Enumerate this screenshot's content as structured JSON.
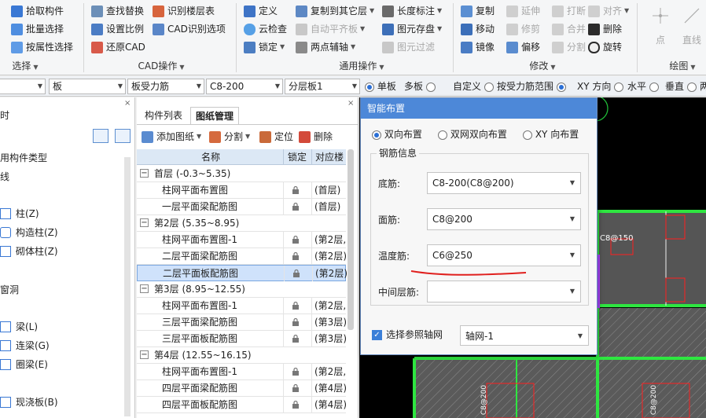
{
  "ribbon": {
    "col1": [
      "拾取构件",
      "批量选择",
      "按属性选择"
    ],
    "col2": [
      "查找替换",
      "设置比例",
      "还原CAD"
    ],
    "col3": [
      "识别楼层表",
      "CAD识别选项"
    ],
    "col4": [
      "定义",
      "云检查",
      "锁定"
    ],
    "col5": [
      "复制到其它层",
      "自动平齐板",
      "两点辅轴"
    ],
    "col6": [
      "长度标注",
      "图元存盘",
      "图元过滤"
    ],
    "col7": [
      "复制",
      "移动",
      "镜像"
    ],
    "col8": [
      "延伸",
      "修剪",
      "偏移"
    ],
    "col9": [
      "打断",
      "合并",
      "分割"
    ],
    "col10": [
      "对齐",
      "删除",
      "旋转"
    ],
    "col11": [
      "点",
      "直线"
    ],
    "groups": [
      "选择",
      "CAD操作",
      "通用操作",
      "修改",
      "绘图"
    ]
  },
  "propbar": {
    "combo2": "板",
    "combo3": "板受力筋",
    "combo4": "C8-200",
    "combo5": "分层板1",
    "options": [
      "单板",
      "多板",
      "自定义",
      "按受力筋范围",
      "XY 方向",
      "水平",
      "垂直",
      "两"
    ]
  },
  "leftpanel": {
    "partial_top": "时",
    "partial_type": "用构件类型",
    "partial_line": "线",
    "items": [
      "柱(Z)",
      "构造柱(Z)",
      "砌体柱(Z)",
      "梁(L)",
      "连梁(G)",
      "圈梁(E)",
      "现浇板(B)"
    ],
    "partial_hole": "窗洞"
  },
  "drawing_panel": {
    "tabs": [
      "构件列表",
      "图纸管理"
    ],
    "toolbar": [
      "添加图纸",
      "分割",
      "定位",
      "删除"
    ],
    "headers": [
      "名称",
      "锁定",
      "对应楼"
    ],
    "groups": [
      {
        "name": "首层 (-0.3~5.35)",
        "rows": [
          [
            "柱网平面布置图",
            "(首层)"
          ],
          [
            "一层平面梁配筋图",
            "(首层)"
          ]
        ]
      },
      {
        "name": "第2层 (5.35~8.95)",
        "rows": [
          [
            "柱网平面布置图-1",
            "(第2层,"
          ],
          [
            "二层平面梁配筋图",
            "(第2层)"
          ],
          [
            "二层平面板配筋图",
            "(第2层)"
          ]
        ]
      },
      {
        "name": "第3层 (8.95~12.55)",
        "rows": [
          [
            "柱网平面布置图-1",
            "(第2层,"
          ],
          [
            "三层平面梁配筋图",
            "(第3层)"
          ],
          [
            "三层平面板配筋图",
            "(第3层)"
          ]
        ]
      },
      {
        "name": "第4层 (12.55~16.15)",
        "rows": [
          [
            "柱网平面布置图-1",
            "(第2层,"
          ],
          [
            "四层平面梁配筋图",
            "(第4层)"
          ],
          [
            "四层平面板配筋图",
            "(第4层)"
          ]
        ]
      }
    ]
  },
  "dialog": {
    "title": "智能布置",
    "modes": [
      "双向布置",
      "双网双向布置",
      "XY 向布置"
    ],
    "section": "钢筋信息",
    "bottom_label": "底筋:",
    "bottom_value": "C8-200(C8@200)",
    "top_label": "面筋:",
    "top_value": "C8@200",
    "temp_label": "温度筋:",
    "temp_value": "C6@250",
    "mid_label": "中间层筋:",
    "mid_value": "",
    "ref_axis_label": "选择参照轴网",
    "ref_axis_value": "轴网-1"
  },
  "canvas": {
    "label1": "C8@150",
    "label2": "C8@200",
    "label3": "C8@200"
  }
}
